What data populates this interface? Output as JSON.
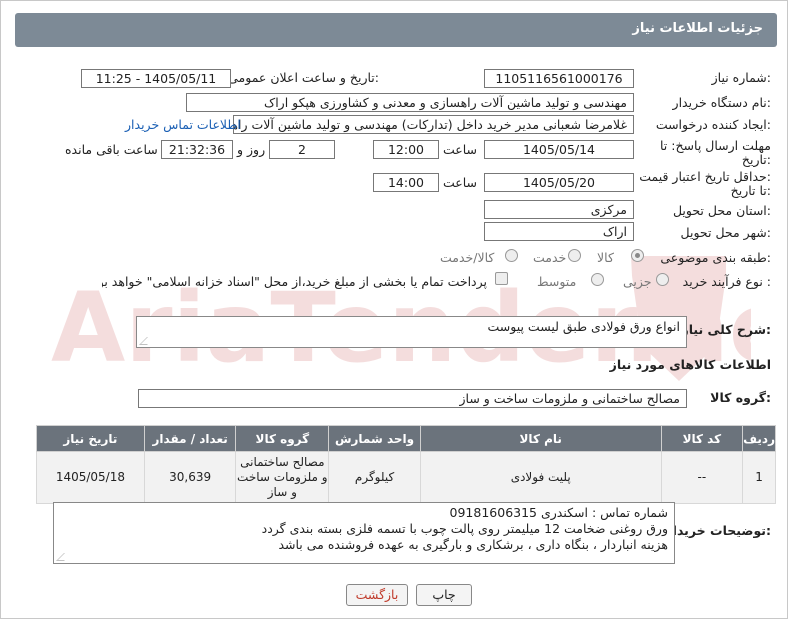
{
  "header": {
    "title": "جزئیات اطلاعات نیاز"
  },
  "fields": {
    "need_number": {
      "label": "شماره نیاز:",
      "value": "1105116561000176"
    },
    "announce_datetime": {
      "label": "تاریخ و ساعت اعلان عمومی:",
      "value": "1405/05/11 - 11:25"
    },
    "buyer_org": {
      "label": "نام دستگاه خریدار:",
      "value": "مهندسی و تولید ماشین آلات راهسازی و معدنی و کشاورزی هپکو اراک"
    },
    "requester": {
      "label": "ایجاد کننده درخواست:",
      "value": "غلامرضا شعبانی مدیر خرید داخل (تدارکات) مهندسی و تولید ماشین آلات راهسا",
      "link": "اطلاعات تماس خریدار"
    },
    "deadline": {
      "label_line1": "مهلت ارسال پاسخ: تا",
      "label_line2": "تاریخ:",
      "date": "1405/05/14",
      "time_label": "ساعت",
      "time": "12:00",
      "days": "2",
      "days_label": "روز و",
      "remaining": "21:32:36",
      "remaining_label": "ساعت باقی مانده"
    },
    "price_validity": {
      "label_line1": "حداقل تاریخ اعتبار قیمت:",
      "label_line2": "تا تاریخ:",
      "date": "1405/05/20",
      "time_label": "ساعت",
      "time": "14:00"
    },
    "province": {
      "label": "استان محل تحویل:",
      "value": "مرکزی"
    },
    "city": {
      "label": "شهر محل تحویل:",
      "value": "اراک"
    },
    "category": {
      "label": "طبقه بندی موضوعی:",
      "options": [
        "کالا",
        "خدمت",
        "کالا/خدمت"
      ]
    },
    "process": {
      "label": "نوع فرآیند خرید :",
      "options": [
        "جزیی",
        "متوسط"
      ],
      "payment_note": "پرداخت تمام یا بخشی از مبلغ خرید،از محل \"اسناد خزانه اسلامی\" خواهد بود."
    }
  },
  "description": {
    "label": "شرح کلی نیاز:",
    "value": "انواع ورق فولادی طبق لیست پیوست"
  },
  "goods_section_title": "اطلاعات کالاهای مورد نیاز",
  "goods_group": {
    "label": "گروه کالا:",
    "value": "مصالح ساختمانی و ملزومات ساخت و ساز"
  },
  "table": {
    "headers": [
      "ردیف",
      "کد کالا",
      "نام کالا",
      "واحد شمارش",
      "گروه کالا",
      "تعداد / مقدار",
      "تاریخ نیاز"
    ],
    "rows": [
      [
        "1",
        "--",
        "پلیت فولادی",
        "کیلوگرم",
        "مصالح ساختمانی و ملزومات ساخت و ساز",
        "30,639",
        "1405/05/18"
      ]
    ]
  },
  "buyer_notes": {
    "label": "توضیحات خریدار:",
    "lines": [
      "شماره تماس : اسکندری 09181606315",
      "ورق روغنی ضخامت 12 میلیمتر روی پالت چوب با تسمه فلزی بسته بندی گردد",
      "هزینه انباردار ، بنگاه داری ، برشکاری و بارگیری به عهده فروشنده می باشد"
    ]
  },
  "buttons": {
    "print": "چاپ",
    "back": "بازگشت"
  },
  "watermark": {
    "text": "AriaTender.neT"
  },
  "colors": {
    "header_bg": "#7d8a96",
    "table_header_bg": "#6b737c",
    "link": "#1a5fb4",
    "back_button_text": "#c03b2b"
  }
}
